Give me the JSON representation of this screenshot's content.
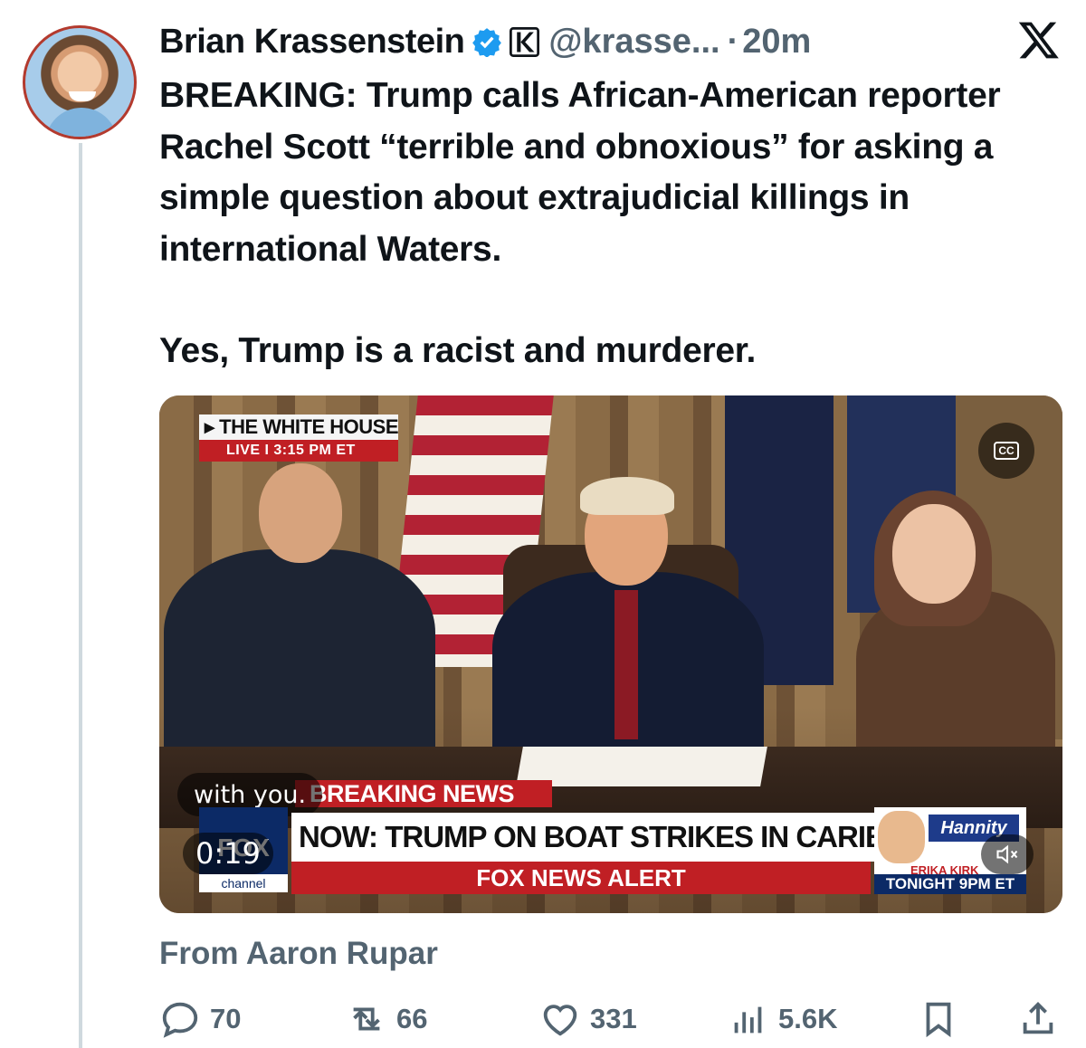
{
  "author": {
    "name": "Brian Krassenstein",
    "handle": "@krasse...",
    "separator": "·",
    "time": "20m"
  },
  "tweet": {
    "line1": "BREAKING: Trump calls African-American reporter Rachel Scott “terrible and obnoxious” for asking a simple question about extrajudicial killings in international Waters.",
    "line2": "Yes, Trump is a racist and murderer."
  },
  "media": {
    "live_title": "THE WHITE HOUSE",
    "live_label": "LIVE  I  3:15 PM ET",
    "cc": "CC",
    "caption": "with you.",
    "breaking": "BREAKING NEWS",
    "network": "FOX",
    "network_sub": "channel",
    "headline": "NOW: TRUMP ON BOAT STRIKES IN CARIBBEAN",
    "alert": "FOX NEWS ALERT",
    "promo_show": "Hannity",
    "promo_host": "ERIKA KIRK",
    "promo_time": "TONIGHT 9PM ET",
    "timer": "0:19"
  },
  "source": "From Aaron Rupar",
  "actions": {
    "replies": "70",
    "reposts": "66",
    "likes": "331",
    "views": "5.6K"
  },
  "icons": [
    "verified-badge-icon",
    "affiliate-badge-icon",
    "x-logo-icon",
    "cc-icon",
    "mute-icon",
    "reply-icon",
    "repost-icon",
    "like-icon",
    "views-icon",
    "bookmark-icon",
    "share-icon"
  ],
  "colors": {
    "verified": "#1d9bf0",
    "muted_text": "#536471",
    "fox_red": "#c01f24",
    "fox_blue": "#0c2a66"
  }
}
